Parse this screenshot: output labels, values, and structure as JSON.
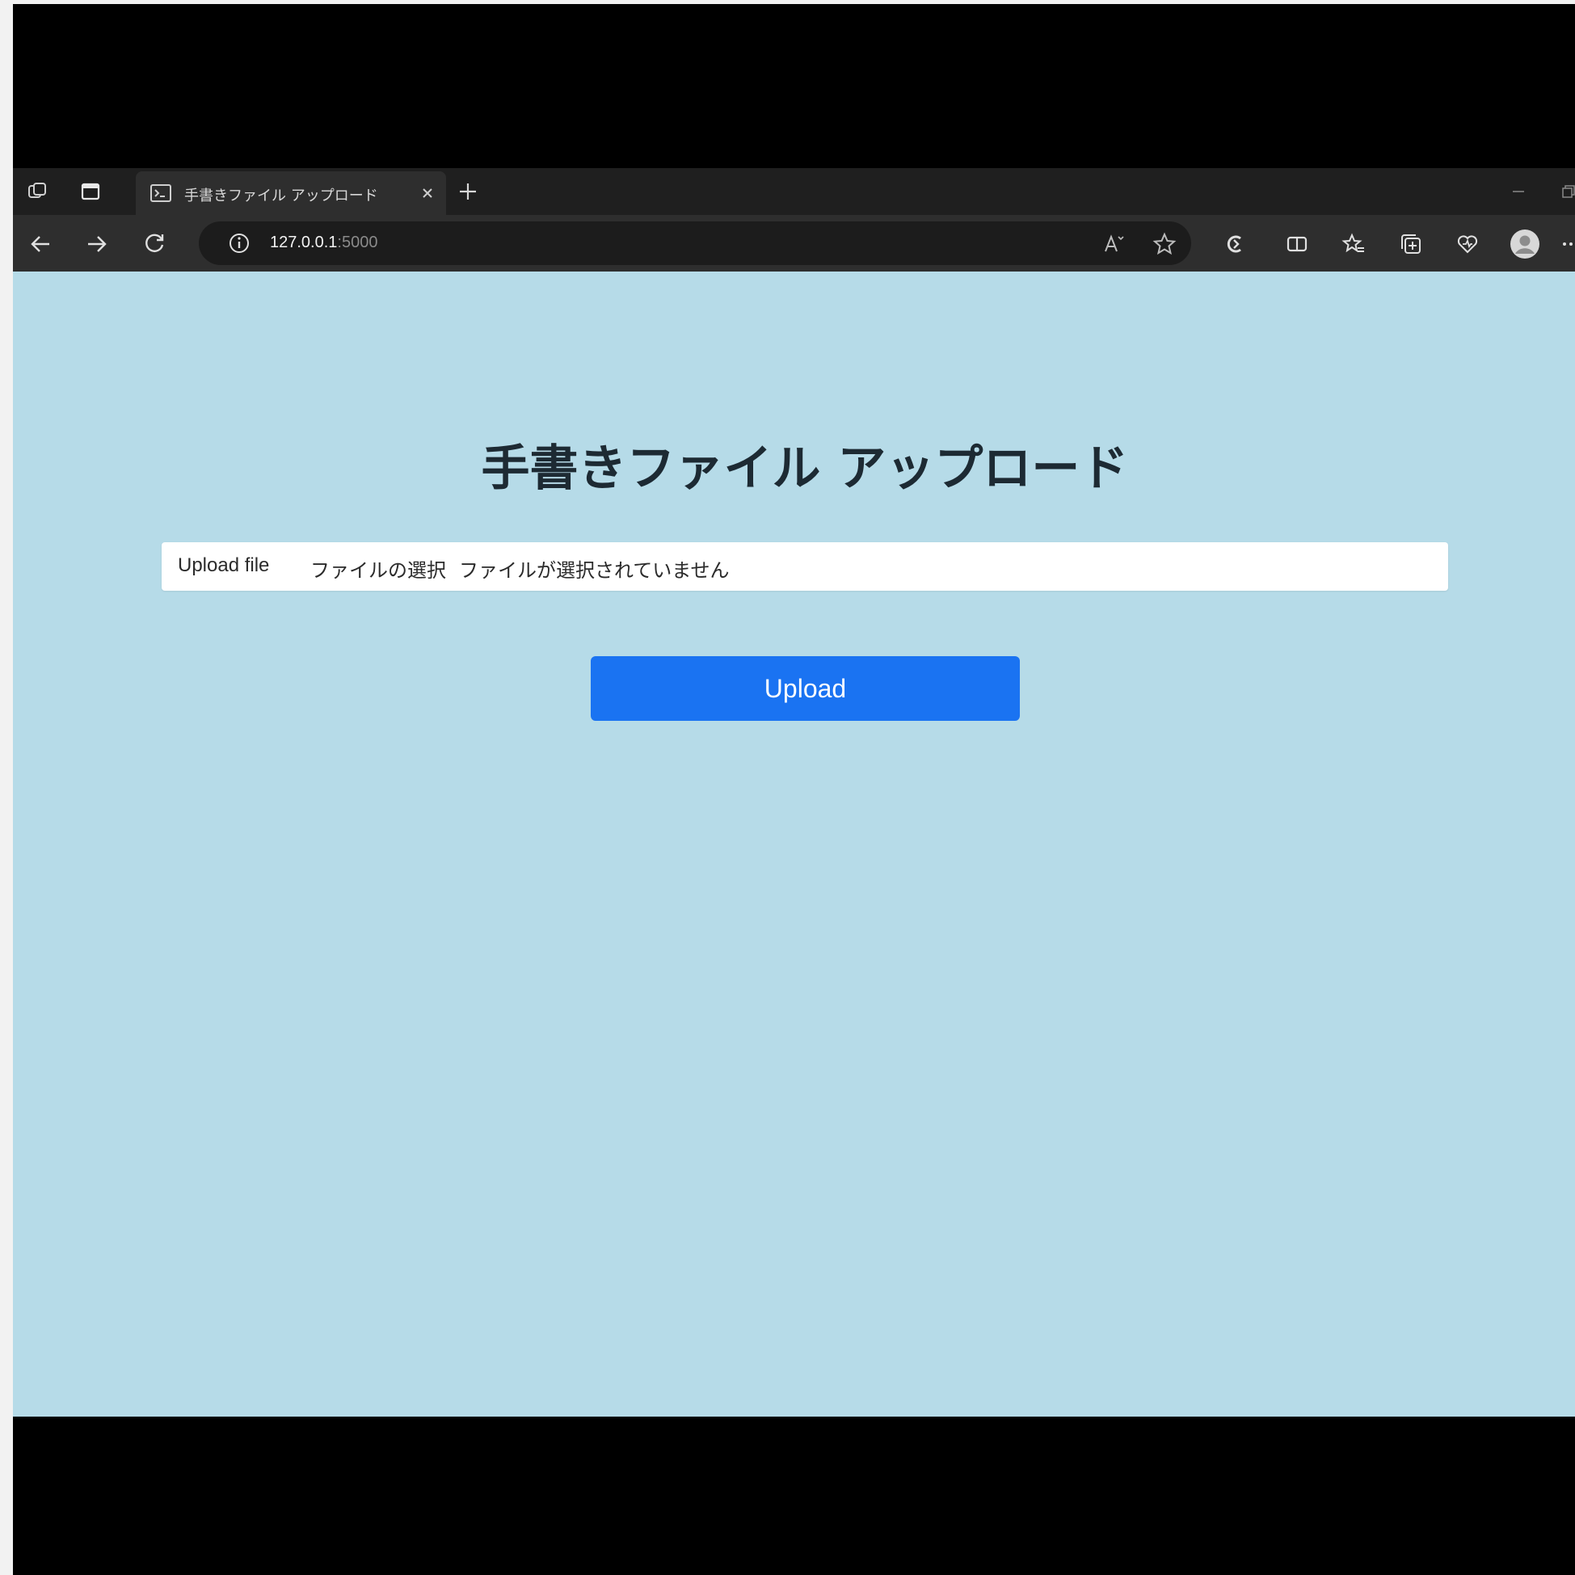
{
  "browser": {
    "tab_title": "手書きファイル アップロード",
    "url_host": "127.0.0.1",
    "url_port": ":5000"
  },
  "page": {
    "title": "手書きファイル アップロード",
    "file_label": "Upload file",
    "file_choose_button": "ファイルの選択",
    "file_status": "ファイルが選択されていません",
    "upload_button": "Upload"
  },
  "colors": {
    "page_background": "#b6dbe8",
    "button_blue": "#1a73f2",
    "browser_chrome": "#2e2e2e"
  },
  "icons": [
    "workspaces-icon",
    "tab-actions-icon",
    "terminal-favicon-icon",
    "close-icon",
    "plus-icon",
    "minimize-icon",
    "restore-icon",
    "back-arrow-icon",
    "forward-arrow-icon",
    "refresh-icon",
    "info-icon",
    "read-aloud-icon",
    "star-icon",
    "copilot-icon",
    "split-screen-icon",
    "favorites-icon",
    "collections-icon",
    "heart-icon",
    "profile-avatar-icon",
    "more-icon"
  ]
}
